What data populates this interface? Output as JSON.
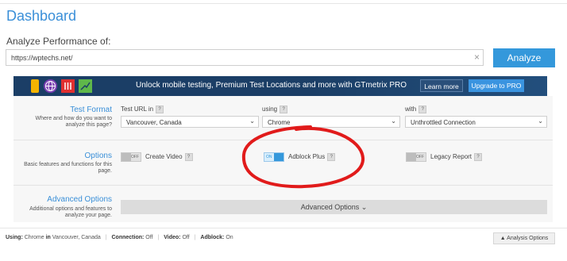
{
  "header": {
    "title": "Dashboard"
  },
  "analyze": {
    "label": "Analyze Performance of:",
    "url_value": "https://wptechs.net/",
    "clear_glyph": "×",
    "button_label": "Analyze"
  },
  "banner": {
    "icons": [
      "phone-icon",
      "globe-icon",
      "equalizer-icon",
      "trend-chart-icon"
    ],
    "text": "Unlock mobile testing, Premium Test Locations and more with GTmetrix PRO",
    "learn_more_label": "Learn more",
    "upgrade_label": "Upgrade to PRO"
  },
  "test_format": {
    "heading": "Test Format",
    "description": "Where and how do you want to analyze this page?",
    "url_in_label": "Test URL in",
    "location_value": "Vancouver, Canada",
    "using_label": "using",
    "browser_value": "Chrome",
    "with_label": "with",
    "connection_value": "Unthrottled Connection",
    "help_glyph": "?"
  },
  "options": {
    "heading": "Options",
    "description": "Basic features and functions for this page.",
    "create_video": {
      "label": "Create Video",
      "state_text": "OFF"
    },
    "adblock_plus": {
      "label": "Adblock Plus",
      "state_text": "ON"
    },
    "legacy_report": {
      "label": "Legacy Report",
      "state_text": "OFF"
    }
  },
  "advanced": {
    "heading": "Advanced Options",
    "description": "Additional options and features to analyze your page.",
    "button_label": "Advanced Options ⌄"
  },
  "summary": {
    "using_key": "Using:",
    "using_value": "Chrome",
    "in_word": "in",
    "location": "Vancouver, Canada",
    "connection_key": "Connection:",
    "connection_value": "Off",
    "video_key": "Video:",
    "video_value": "Off",
    "adblock_key": "Adblock:",
    "adblock_value": "On",
    "sep": "|",
    "analysis_options_label": "▲ Analysis Options"
  },
  "colors": {
    "accent": "#3498db",
    "banner_bg": "#1b3e66",
    "annotation": "#e11b1b"
  }
}
